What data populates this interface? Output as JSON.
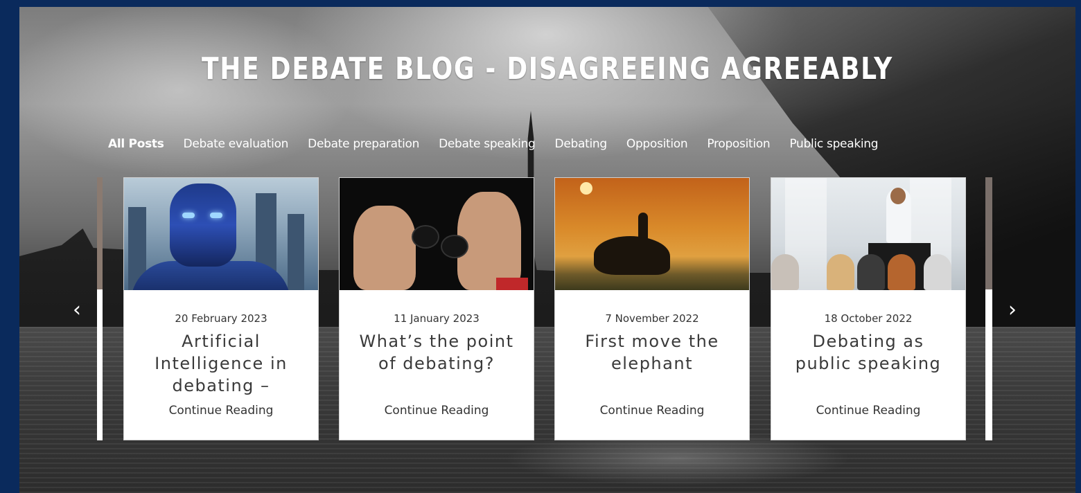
{
  "blog": {
    "title": "THE DEBATE BLOG - DISAGREEING AGREEABLY"
  },
  "categories": [
    {
      "label": "All Posts",
      "active": true
    },
    {
      "label": "Debate evaluation",
      "active": false
    },
    {
      "label": "Debate preparation",
      "active": false
    },
    {
      "label": "Debate speaking",
      "active": false
    },
    {
      "label": "Debating",
      "active": false
    },
    {
      "label": "Opposition",
      "active": false
    },
    {
      "label": "Proposition",
      "active": false
    },
    {
      "label": "Public speaking",
      "active": false
    }
  ],
  "carousel": {
    "prev_icon": "‹",
    "next_icon": "›",
    "posts": [
      {
        "date": "20 February 2023",
        "title": "Artificial Intelligence in debating –",
        "link_label": "Continue Reading",
        "image": "robot-image"
      },
      {
        "date": "11 January 2023",
        "title": "What’s the point of debating?",
        "link_label": "Continue Reading",
        "image": "boxing-image"
      },
      {
        "date": "7 November 2022",
        "title": "First move the elephant",
        "link_label": "Continue Reading",
        "image": "elephant-image"
      },
      {
        "date": "18 October 2022",
        "title": "Debating as public speaking",
        "link_label": "Continue Reading",
        "image": "speaker-image"
      }
    ]
  },
  "colors": {
    "frame": "#0a2a5c",
    "text_on_hero": "#ffffff",
    "card_bg": "#ffffff",
    "card_text": "#333333"
  }
}
